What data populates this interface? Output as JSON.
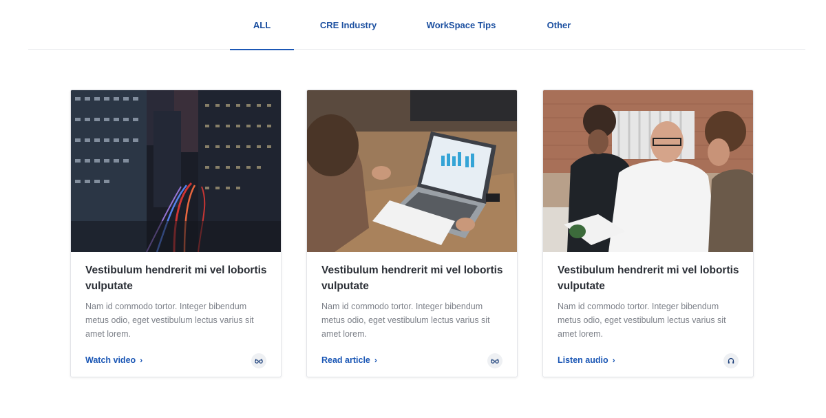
{
  "tabs": [
    {
      "label": "ALL",
      "active": true
    },
    {
      "label": "CRE Industry",
      "active": false
    },
    {
      "label": "WorkSpace Tips",
      "active": false
    },
    {
      "label": "Other",
      "active": false
    }
  ],
  "cards": [
    {
      "image": "city-night-buildings-photo",
      "title": "Vestibulum hendrerit mi vel lobortis vulputate",
      "description": "Nam id commodo tortor. Integer bibendum metus odio, eget vestibulum lectus varius sit amet lorem.",
      "link_label": "Watch video",
      "type_icon": "glasses-icon"
    },
    {
      "image": "laptop-desk-photo",
      "title": "Vestibulum hendrerit mi vel lobortis vulputate",
      "description": "Nam id commodo tortor. Integer bibendum metus odio, eget vestibulum lectus varius sit amet lorem.",
      "link_label": "Read article",
      "type_icon": "glasses-icon"
    },
    {
      "image": "team-meeting-photo",
      "title": "Vestibulum hendrerit mi vel lobortis vulputate",
      "description": "Nam id commodo tortor. Integer bibendum metus odio, eget vestibulum lectus varius sit amet lorem.",
      "link_label": "Listen audio",
      "type_icon": "headphones-icon"
    }
  ],
  "colors": {
    "accent": "#1b57b5",
    "tab_text": "#1b4fa0",
    "title": "#2b2f36",
    "body": "#7d8189"
  }
}
